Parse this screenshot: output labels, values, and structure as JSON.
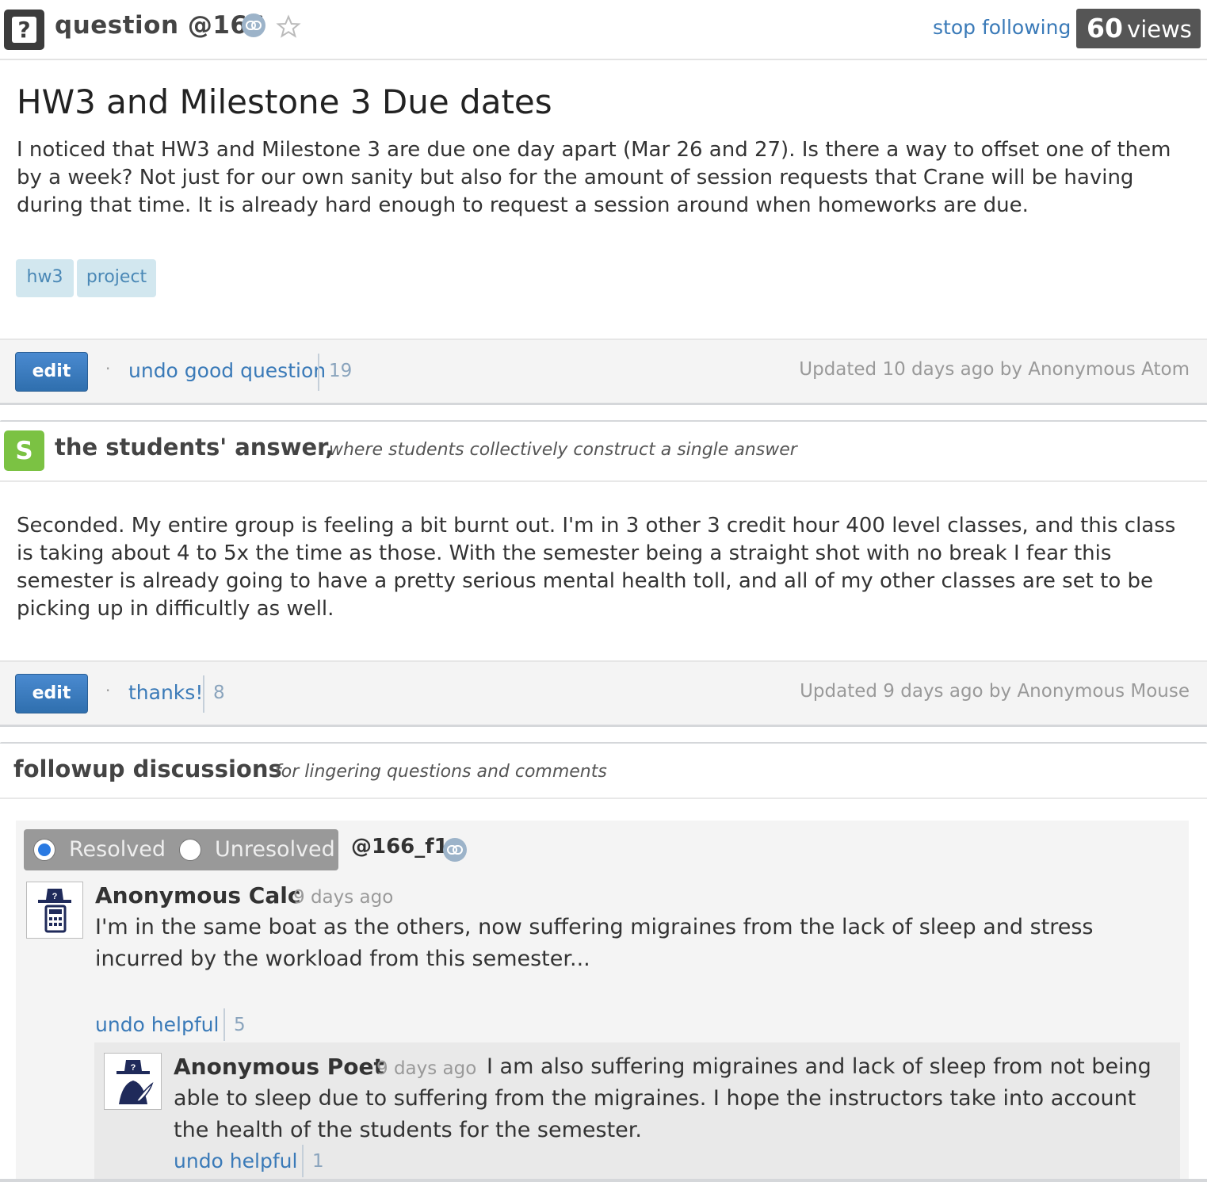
{
  "header": {
    "type_icon": "question-mark",
    "question_label": "question @166",
    "stop_following": "stop following",
    "views_count": "60",
    "views_label": "views"
  },
  "question": {
    "title": "HW3 and Milestone 3 Due dates",
    "body": "I noticed that HW3 and Milestone 3 are due one day apart (Mar 26 and 27). Is there a way to offset one of them by a week? Not just for our own sanity but also for the amount of session requests that Crane will be having during that time. It is already hard enough to request a session around when homeworks are due.",
    "tags": [
      "hw3",
      "project"
    ],
    "edit_label": "edit",
    "action_link": "undo good question",
    "action_count": "19",
    "updated": "Updated 10 days ago by Anonymous Atom"
  },
  "students_answer": {
    "icon_letter": "S",
    "title": "the students' answer,",
    "subtitle": "where students collectively construct a single answer",
    "body": "Seconded. My entire group is feeling a bit burnt out. I'm in 3 other 3 credit hour 400 level classes, and this class is taking about 4 to 5x the time as those. With the semester being a straight shot with no break I fear this semester is already going to have a pretty serious mental health toll, and all of my other classes are set to be picking up in difficultly as well.",
    "edit_label": "edit",
    "action_link": "thanks!",
    "action_count": "8",
    "updated": "Updated 9 days ago by Anonymous Mouse"
  },
  "followup": {
    "title": "followup discussions",
    "subtitle": "for lingering questions and comments",
    "resolved_label": "Resolved",
    "unresolved_label": "Unresolved",
    "resolved_selected": true,
    "id": "@166_f1",
    "post": {
      "author": "Anonymous Calc",
      "ago": "9 days ago",
      "avatar_icon": "anonymous-calculator-avatar",
      "text": "I'm in the same boat as the others, now suffering migraines from the lack of sleep and stress incurred by the workload from this semester...",
      "helpful_link": "undo helpful",
      "helpful_count": "5"
    },
    "reply": {
      "author": "Anonymous Poet",
      "ago": "9 days ago",
      "avatar_icon": "anonymous-quill-avatar",
      "text": "I am also suffering migraines and lack of sleep from not being able to sleep due to suffering from the migraines. I hope the instructors take into account the health of the students for the semester.",
      "helpful_link": "undo helpful",
      "helpful_count": "1"
    }
  },
  "colors": {
    "link": "#3a7ab8",
    "tag_bg": "#d2e7ef",
    "students_icon": "#7bc243",
    "edit_button": "#3b7dc0",
    "views_badge": "#555555"
  }
}
